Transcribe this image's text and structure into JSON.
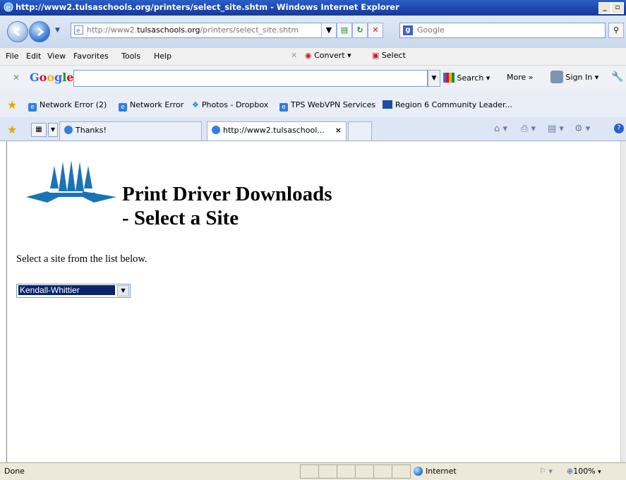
{
  "window": {
    "title": "http://www2.tulsaschools.org/printers/select_site.shtm - Windows Internet Explorer"
  },
  "address_bar": {
    "url_prefix": "http://www2.",
    "url_domain": "tulsaschools.org",
    "url_path": "/printers/select_site.shtm",
    "search_placeholder": "Google"
  },
  "menu": {
    "items": [
      "File",
      "Edit",
      "View",
      "Favorites",
      "Tools",
      "Help"
    ],
    "convert_label": "Convert",
    "select_label": "Select"
  },
  "google_toolbar": {
    "logo": "Google",
    "search_label": "Search",
    "more_label": "More »",
    "signin_label": "Sign In"
  },
  "favorites": {
    "items": [
      "Network Error (2)",
      "Network Error",
      "Photos - Dropbox",
      "TPS WebVPN Services",
      "Region 6 Community Leader..."
    ]
  },
  "tabs": {
    "items": [
      {
        "label": "Thanks!"
      },
      {
        "label": "http://www2.tulsaschool...",
        "close": "×"
      }
    ]
  },
  "page": {
    "title_line1": "Print Driver Downloads",
    "title_line2": "- Select a Site",
    "instruction": "Select a site from the list below.",
    "site_select_value": "Kendall-Whittier"
  },
  "status_bar": {
    "status": "Done",
    "zone": "Internet",
    "zoom": "100%"
  },
  "colors": {
    "logo_blue": "#1a73b6",
    "selection_navy": "#0a246a"
  }
}
